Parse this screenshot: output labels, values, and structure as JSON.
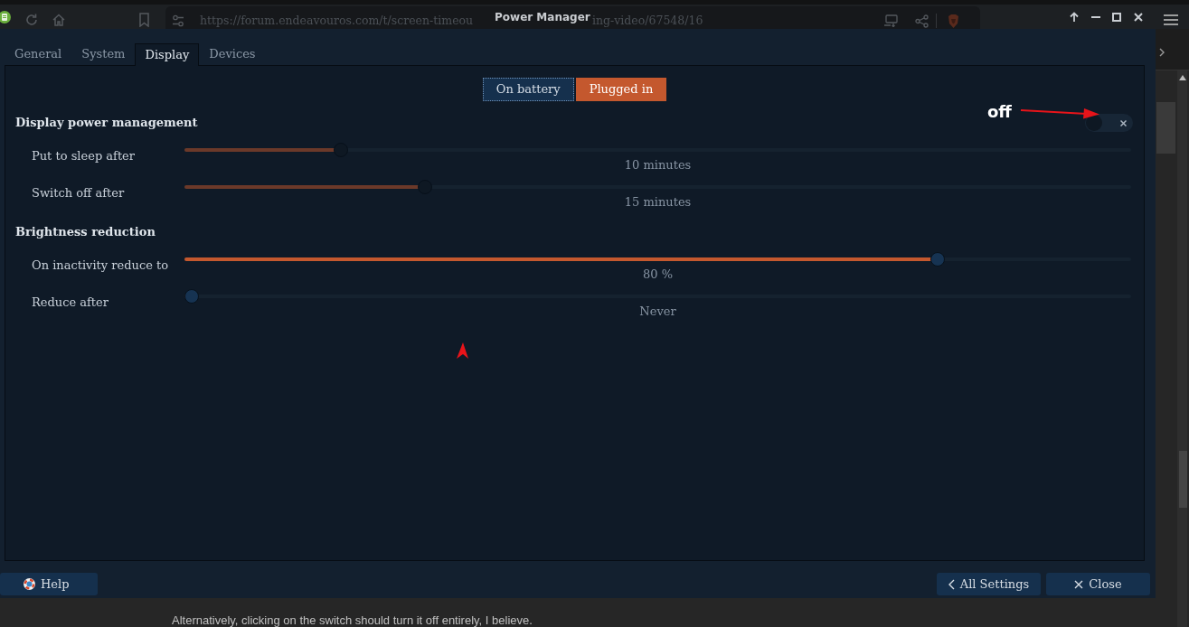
{
  "browser": {
    "address_parts": [
      "https://forum.endeavouros.com/t/screen-timeou",
      "ing-video/67548/16"
    ]
  },
  "window": {
    "title": "Power Manager"
  },
  "tabs": [
    {
      "label": "General",
      "selected": false
    },
    {
      "label": "System",
      "selected": false
    },
    {
      "label": "Display",
      "selected": true
    },
    {
      "label": "Devices",
      "selected": false
    }
  ],
  "profiles": [
    {
      "label": "On battery",
      "selected": false,
      "focused": true
    },
    {
      "label": "Plugged in",
      "selected": true,
      "focused": false
    }
  ],
  "sections": [
    {
      "title": "Display power management",
      "toggle": {
        "on": false
      },
      "rows": [
        {
          "label": "Put to sleep after",
          "level": 0.16,
          "reading": "10 minutes",
          "disabled": true
        },
        {
          "label": "Switch off after",
          "level": 0.25,
          "reading": "15 minutes",
          "disabled": true
        }
      ]
    },
    {
      "title": "Brightness reduction",
      "rows": [
        {
          "label": "On inactivity reduce to",
          "level": 0.8,
          "reading": "80 %",
          "disabled": false
        },
        {
          "label": "Reduce after",
          "level": 0,
          "reading": "Never",
          "disabled": false
        }
      ]
    }
  ],
  "footer_buttons": [
    {
      "kind": "help",
      "label": "Help"
    },
    {
      "kind": "back",
      "label": "All Settings"
    },
    {
      "kind": "close",
      "label": "Close"
    }
  ],
  "annotation": {
    "text": "off"
  },
  "page_text": "Alternatively, clicking on the switch should turn it off entirely, I believe."
}
